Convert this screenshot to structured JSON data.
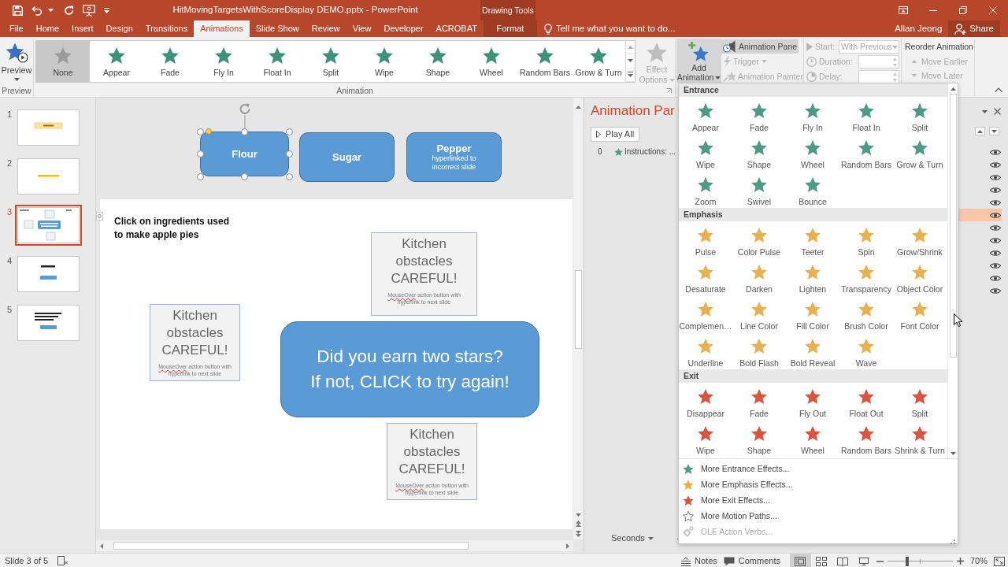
{
  "title_bar": {
    "title": "HitMovingTargetsWithScoreDisplay DEMO.pptx - PowerPoint",
    "contextual_group": "Drawing Tools"
  },
  "tabs": [
    {
      "label": "File",
      "kind": "tab",
      "selected": false
    },
    {
      "label": "Home",
      "kind": "tab",
      "selected": false
    },
    {
      "label": "Insert",
      "kind": "tab",
      "selected": false
    },
    {
      "label": "Design",
      "kind": "tab",
      "selected": false
    },
    {
      "label": "Transitions",
      "kind": "tab",
      "selected": false
    },
    {
      "label": "Animations",
      "kind": "tab",
      "selected": true
    },
    {
      "label": "Slide Show",
      "kind": "tab",
      "selected": false
    },
    {
      "label": "Review",
      "kind": "tab",
      "selected": false
    },
    {
      "label": "View",
      "kind": "tab",
      "selected": false
    },
    {
      "label": "Developer",
      "kind": "tab",
      "selected": false
    },
    {
      "label": "ACROBAT",
      "kind": "tab",
      "selected": false
    },
    {
      "label": "Format",
      "kind": "contextual",
      "selected": false
    }
  ],
  "tell_me": {
    "placeholder": "Tell me what you want to do..."
  },
  "account": {
    "user": "Allan Jeong",
    "share": "Share"
  },
  "ribbon": {
    "preview": {
      "button": "Preview",
      "group_label": "Preview"
    },
    "animation": {
      "effects": [
        {
          "label": "None",
          "kind": "none",
          "selected": true
        },
        {
          "label": "Appear",
          "kind": "effect",
          "selected": false
        },
        {
          "label": "Fade",
          "kind": "effect",
          "selected": false
        },
        {
          "label": "Fly In",
          "kind": "effect",
          "selected": false
        },
        {
          "label": "Float In",
          "kind": "effect",
          "selected": false
        },
        {
          "label": "Split",
          "kind": "effect",
          "selected": false
        },
        {
          "label": "Wipe",
          "kind": "effect",
          "selected": false
        },
        {
          "label": "Shape",
          "kind": "effect",
          "selected": false
        },
        {
          "label": "Wheel",
          "kind": "effect",
          "selected": false
        },
        {
          "label": "Random Bars",
          "kind": "effect",
          "selected": false
        },
        {
          "label": "Grow & Turn",
          "kind": "effect",
          "selected": false
        }
      ],
      "effect_options": {
        "label": "Effect Options",
        "disabled": true
      },
      "group_label": "Animation"
    },
    "advanced": {
      "add_animation": "Add Animation",
      "animation_pane": {
        "label": "Animation Pane",
        "selected": true
      },
      "trigger": {
        "label": "Trigger",
        "disabled": true
      },
      "animation_painter": {
        "label": "Animation Painter",
        "disabled": true
      }
    },
    "timing": {
      "disabled": true,
      "start_label": "Start:",
      "start_value": "With Previous",
      "duration_label": "Duration:",
      "delay_label": "Delay:"
    },
    "reorder": {
      "title": "Reorder Animation",
      "move_earlier": {
        "label": "Move Earlier",
        "disabled": true
      },
      "move_later": {
        "label": "Move Later",
        "disabled": true
      }
    }
  },
  "slides": [
    {
      "number": "1",
      "kind": "banner",
      "selected": false
    },
    {
      "number": "2",
      "kind": "heading",
      "selected": false
    },
    {
      "number": "3",
      "kind": "layout",
      "selected": true
    },
    {
      "number": "4",
      "kind": "button",
      "selected": false
    },
    {
      "number": "5",
      "kind": "text-button",
      "selected": false
    }
  ],
  "editor": {
    "offslide_shapes": [
      {
        "label": "Flour",
        "selected": true
      },
      {
        "label": "Sugar",
        "selected": false
      },
      {
        "label": "Pepper",
        "note": "hyperlinked to\nincorrect slide",
        "selected": false
      }
    ],
    "slide": {
      "animation_tag": "0",
      "instructions": "Click on ingredients used\nto make apple pies",
      "obstacles": [
        {
          "title": "Kitchen\nobstacles\nCAREFUL!",
          "caption": [
            {
              "text": "MouseOver",
              "misspelled": true
            },
            {
              "text": " action button with\nhyperlink to next slide",
              "misspelled": false
            }
          ]
        },
        {
          "title": "Kitchen\nobstacles\nCAREFUL!",
          "caption": [
            {
              "text": "MouseOver",
              "misspelled": true
            },
            {
              "text": " action button with\nhyperlink to next slide",
              "misspelled": false
            }
          ]
        },
        {
          "title": "Kitchen\nobstacles\nCAREFUL!",
          "caption": [
            {
              "text": "MouseOver",
              "misspelled": true
            },
            {
              "text": " action button with\nhyperlink to next slide",
              "misspelled": false
            }
          ]
        }
      ],
      "prompt": "Did you earn two stars?\nIf not, CLICK to try again!"
    }
  },
  "animation_pane": {
    "title": "Animation Par",
    "play_all": "Play All",
    "rows": [
      {
        "number": "0",
        "label": "Instructions: ...",
        "selected": false
      },
      {
        "selected": false
      },
      {
        "selected": false
      },
      {
        "selected": false
      },
      {
        "selected": false
      },
      {
        "selected": true
      },
      {
        "selected": false
      },
      {
        "selected": false
      },
      {
        "selected": false
      },
      {
        "selected": false
      },
      {
        "selected": false
      },
      {
        "selected": false
      }
    ],
    "timeline_unit": "Seconds"
  },
  "dropdown": {
    "sections": [
      {
        "title": "Entrance",
        "color": "#4f9a85",
        "effects": [
          "Appear",
          "Fade",
          "Fly In",
          "Float In",
          "Split",
          "Wipe",
          "Shape",
          "Wheel",
          "Random Bars",
          "Grow & Turn",
          "Zoom",
          "Swivel",
          "Bounce"
        ]
      },
      {
        "title": "Emphasis",
        "color": "#e8b04f",
        "effects": [
          "Pulse",
          "Color Pulse",
          "Teeter",
          "Spin",
          "Grow/Shrink",
          "Desaturate",
          "Darken",
          "Lighten",
          "Transparency",
          "Object Color",
          "Complemen…",
          "Line Color",
          "Fill Color",
          "Brush Color",
          "Font Color",
          "Underline",
          "Bold Flash",
          "Bold Reveal",
          "Wave"
        ]
      },
      {
        "title": "Exit",
        "color": "#d9553f",
        "effects": [
          "Disappear",
          "Fade",
          "Fly Out",
          "Float Out",
          "Split",
          "Wipe",
          "Shape",
          "Wheel",
          "Random Bars",
          "Shrink & Turn"
        ]
      }
    ],
    "commands": [
      {
        "label": "More Entrance Effects...",
        "kind": "star",
        "color": "#4f9a85",
        "disabled": false
      },
      {
        "label": "More Emphasis Effects...",
        "kind": "star",
        "color": "#e8b04f",
        "disabled": false
      },
      {
        "label": "More Exit Effects...",
        "kind": "star",
        "color": "#d9553f",
        "disabled": false
      },
      {
        "label": "More Motion Paths...",
        "kind": "outline-star",
        "disabled": false
      },
      {
        "label": "OLE Action Verbs...",
        "kind": "gear",
        "disabled": true
      }
    ]
  },
  "status_bar": {
    "slide_info": "Slide 3 of 5",
    "notes": "Notes",
    "comments": "Comments",
    "views": [
      {
        "kind": "normal",
        "selected": true
      },
      {
        "kind": "sorter",
        "selected": false
      },
      {
        "kind": "reading",
        "selected": false
      },
      {
        "kind": "slideshow",
        "selected": false
      }
    ],
    "zoom": {
      "level": 0.3,
      "reading": "70%"
    }
  }
}
